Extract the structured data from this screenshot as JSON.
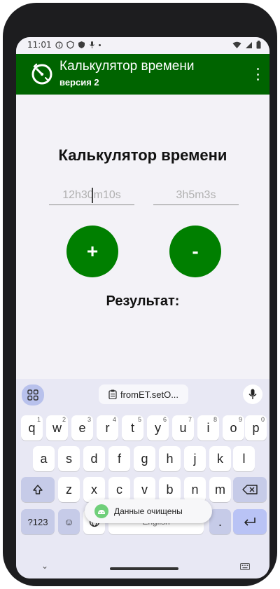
{
  "status_bar": {
    "time": "11:01"
  },
  "app_bar": {
    "title": "Калькулятор времени",
    "subtitle": "версия 2",
    "color": "#006400"
  },
  "main": {
    "title": "Калькулятор времени",
    "input1": {
      "placeholder": "12h30m10s"
    },
    "input2": {
      "placeholder": "3h5m3s"
    },
    "plus_label": "+",
    "minus_label": "-",
    "result_label": "Результат:",
    "button_color": "#007f00"
  },
  "keyboard": {
    "clipboard_text": "fromET.setO...",
    "row1": [
      {
        "k": "q",
        "s": "1"
      },
      {
        "k": "w",
        "s": "2"
      },
      {
        "k": "e",
        "s": "3"
      },
      {
        "k": "r",
        "s": "4"
      },
      {
        "k": "t",
        "s": "5"
      },
      {
        "k": "y",
        "s": "6"
      },
      {
        "k": "u",
        "s": "7"
      },
      {
        "k": "i",
        "s": "8"
      },
      {
        "k": "o",
        "s": "9"
      },
      {
        "k": "p",
        "s": "0"
      }
    ],
    "row2": [
      "a",
      "s",
      "d",
      "f",
      "g",
      "h",
      "j",
      "k",
      "l"
    ],
    "row3": [
      "z",
      "x",
      "c",
      "v",
      "b",
      "n",
      "m"
    ],
    "sym_label": "?123",
    "emoji_label": "☺",
    "comma_label": ",",
    "space_label": "English",
    "period_label": "."
  },
  "toast": {
    "text": "Данные очищены"
  },
  "icons": {
    "wifi": "wifi-icon",
    "signal": "signal-icon",
    "battery": "battery-icon",
    "mic": "mic-icon",
    "clipboard": "clipboard-icon",
    "apps": "apps-grid-icon",
    "backspace": "backspace-icon",
    "enter": "enter-icon",
    "shift": "shift-icon"
  }
}
